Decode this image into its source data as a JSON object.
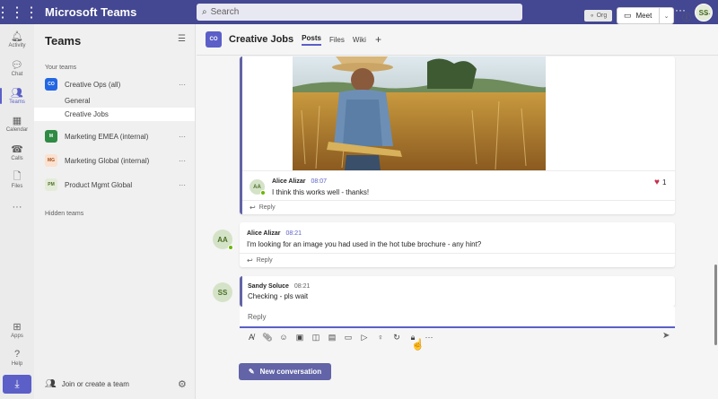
{
  "titlebar": {
    "app_name": "Microsoft Teams",
    "search_placeholder": "Search",
    "more": "···",
    "user_initials": "SS",
    "accent": "#444791"
  },
  "rail": {
    "items": [
      {
        "label": "Activity",
        "icon": "bell-icon"
      },
      {
        "label": "Chat",
        "icon": "chat-icon"
      },
      {
        "label": "Teams",
        "icon": "teams-icon"
      },
      {
        "label": "Calendar",
        "icon": "calendar-icon"
      },
      {
        "label": "Calls",
        "icon": "phone-icon"
      },
      {
        "label": "Files",
        "icon": "file-icon"
      }
    ],
    "more": "···",
    "apps_label": "Apps",
    "help_label": "Help"
  },
  "panel": {
    "title": "Teams",
    "your_teams_label": "Your teams",
    "teams": [
      {
        "initials": "CO",
        "name": "Creative Ops (all)",
        "bg": "#2266e3",
        "fg": "#ffffff"
      },
      {
        "initials": "M",
        "name": "Marketing EMEA (internal)",
        "bg": "#2f8a44",
        "fg": "#ffffff"
      },
      {
        "initials": "MG",
        "name": "Marketing Global (internal)",
        "bg": "#fbe1cf",
        "fg": "#a44d1b"
      },
      {
        "initials": "PM",
        "name": "Product Mgmt Global",
        "bg": "#e4ecd9",
        "fg": "#4b6e25"
      }
    ],
    "channels": [
      "General",
      "Creative Jobs"
    ],
    "hidden_label": "Hidden teams",
    "join_label": "Join or create a team"
  },
  "channel_header": {
    "initials": "CO",
    "name": "Creative Jobs",
    "tabs": [
      "Posts",
      "Files",
      "Wiki"
    ],
    "org_label": "Org",
    "meet_label": "Meet"
  },
  "posts": [
    {
      "author": "Alice Alizar",
      "initials": "AA",
      "time": "08:07",
      "text": "I think this works well - thanks!",
      "reaction_count": "1",
      "reply_label": "Reply"
    },
    {
      "author": "Alice Alizar",
      "initials": "AA",
      "time": "08:21",
      "text": "I'm looking for an image you had used in the hot tube brochure - any hint?",
      "reply_label": "Reply"
    },
    {
      "author": "Sandy Soluce",
      "initials": "SS",
      "time": "08:21",
      "text": "Checking - pls wait"
    }
  ],
  "composer": {
    "placeholder": "Reply",
    "new_conversation_label": "New conversation"
  }
}
